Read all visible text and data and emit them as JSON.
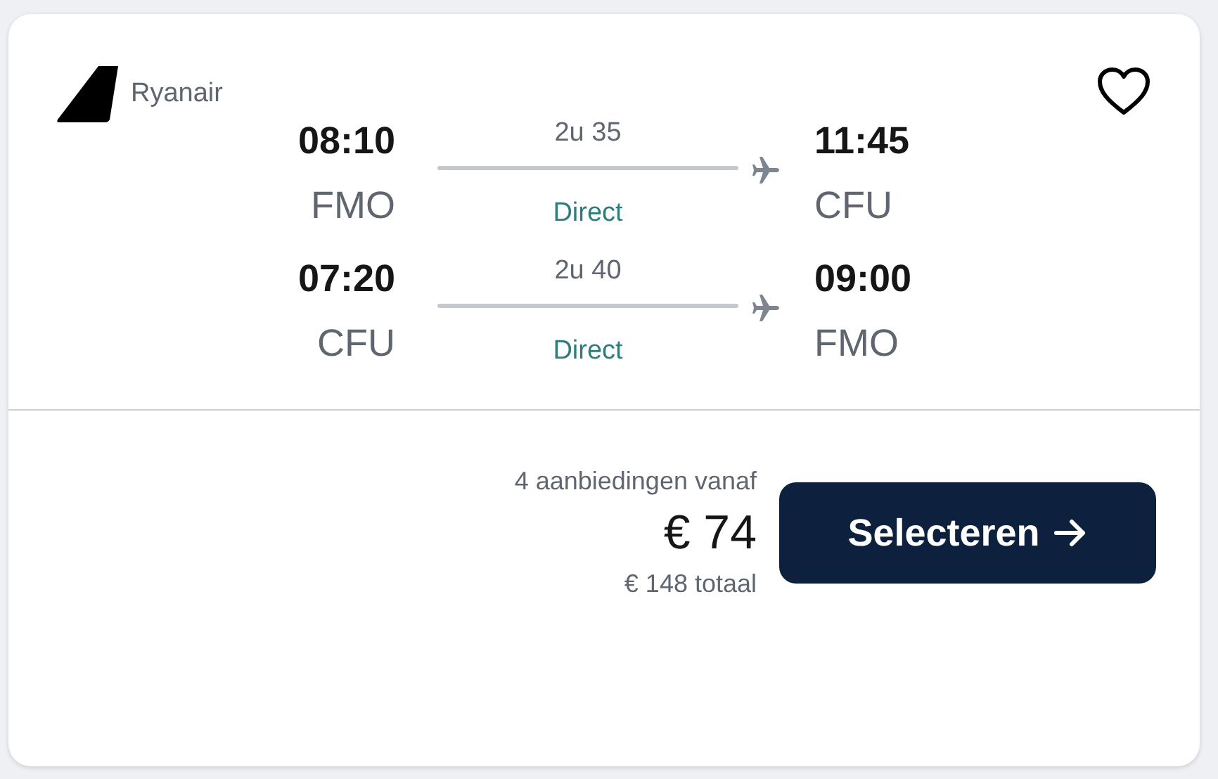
{
  "airline": {
    "name": "Ryanair"
  },
  "favorite": {
    "saved": false
  },
  "legs": [
    {
      "departure_time": "08:10",
      "departure_airport": "FMO",
      "duration": "2u 35",
      "stops": "Direct",
      "arrival_time": "11:45",
      "arrival_airport": "CFU"
    },
    {
      "departure_time": "07:20",
      "departure_airport": "CFU",
      "duration": "2u 40",
      "stops": "Direct",
      "arrival_time": "09:00",
      "arrival_airport": "FMO"
    }
  ],
  "offer": {
    "deals": "4 aanbiedingen vanaf",
    "price": "€ 74",
    "total": "€ 148 totaal",
    "button": "Selecteren"
  }
}
